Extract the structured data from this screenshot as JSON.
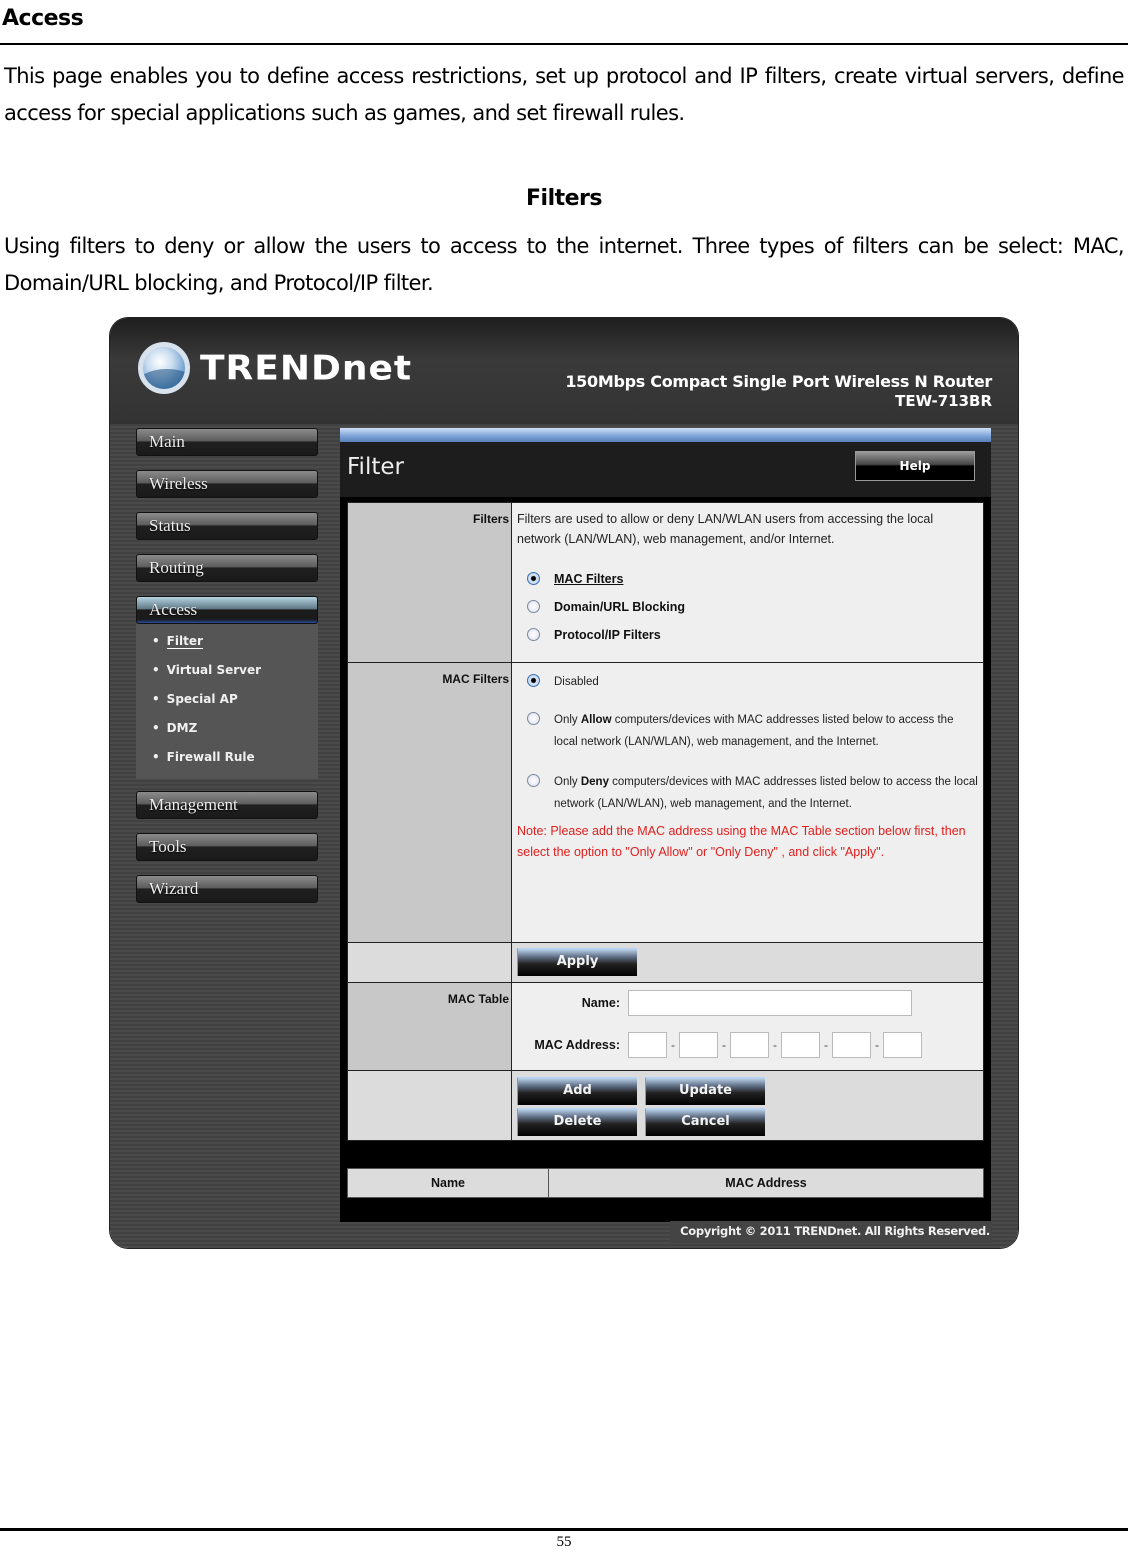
{
  "document": {
    "heading": "Access",
    "intro": "This page enables you to define access restrictions, set up protocol and IP filters, create virtual servers, define access for special applications such as games, and set firewall rules.",
    "subheading": "Filters",
    "filters_text": "Using filters to deny or allow the users to access to the internet.  Three types of filters can be select: MAC, Domain/URL blocking, and Protocol/IP filter.",
    "page_number": "55"
  },
  "router": {
    "brand": "TRENDnet",
    "product_title": "150Mbps Compact Single Port Wireless N Router",
    "model": "TEW-713BR",
    "copyright": "Copyright © 2011 TRENDnet. All Rights Reserved.",
    "nav": {
      "items": [
        {
          "label": "Main"
        },
        {
          "label": "Wireless"
        },
        {
          "label": "Status"
        },
        {
          "label": "Routing"
        },
        {
          "label": "Access",
          "active": true
        },
        {
          "label": "Management"
        },
        {
          "label": "Tools"
        },
        {
          "label": "Wizard"
        }
      ],
      "access_subitems": [
        {
          "label": "Filter",
          "current": true
        },
        {
          "label": "Virtual Server"
        },
        {
          "label": "Special AP"
        },
        {
          "label": "DMZ"
        },
        {
          "label": "Firewall Rule"
        }
      ],
      "bullet": "•"
    },
    "page": {
      "title": "Filter",
      "help_label": "Help",
      "filters_section": {
        "label": "Filters",
        "description": "Filters are used to allow or deny LAN/WLAN users from accessing the local network (LAN/WLAN), web management, and/or Internet.",
        "options": [
          {
            "label": "MAC Filters",
            "checked": true
          },
          {
            "label": "Domain/URL Blocking",
            "checked": false
          },
          {
            "label": "Protocol/IP Filters",
            "checked": false
          }
        ]
      },
      "mac_filters_section": {
        "label": "MAC Filters",
        "options": [
          {
            "label": "Disabled",
            "checked": true
          },
          {
            "prefix": "Only ",
            "bold": "Allow",
            "suffix": " computers/devices with MAC addresses listed below to access the local network (LAN/WLAN), web management, and the Internet.",
            "checked": false
          },
          {
            "prefix": "Only ",
            "bold": "Deny",
            "suffix": " computers/devices with MAC addresses listed below to access the local network (LAN/WLAN), web management, and the Internet.",
            "checked": false
          }
        ],
        "note": "Note: Please add the MAC address using the MAC Table section below first, then select the option to \"Only Allow\" or \"Only Deny\" , and click \"Apply\"."
      },
      "apply_label": "Apply",
      "mac_table_section": {
        "label": "MAC Table",
        "name_label": "Name:",
        "name_value": "",
        "mac_label": "MAC Address:",
        "mac_octets": [
          "",
          "",
          "",
          "",
          "",
          ""
        ],
        "separator": "-"
      },
      "buttons": {
        "add": "Add",
        "update": "Update",
        "delete": "Delete",
        "cancel": "Cancel"
      },
      "list_headers": [
        "Name",
        "MAC Address"
      ]
    },
    "colors": {
      "note_red": "#e0201e",
      "frame_dark": "#414141",
      "accent_blue": "#7aa0d8"
    }
  }
}
